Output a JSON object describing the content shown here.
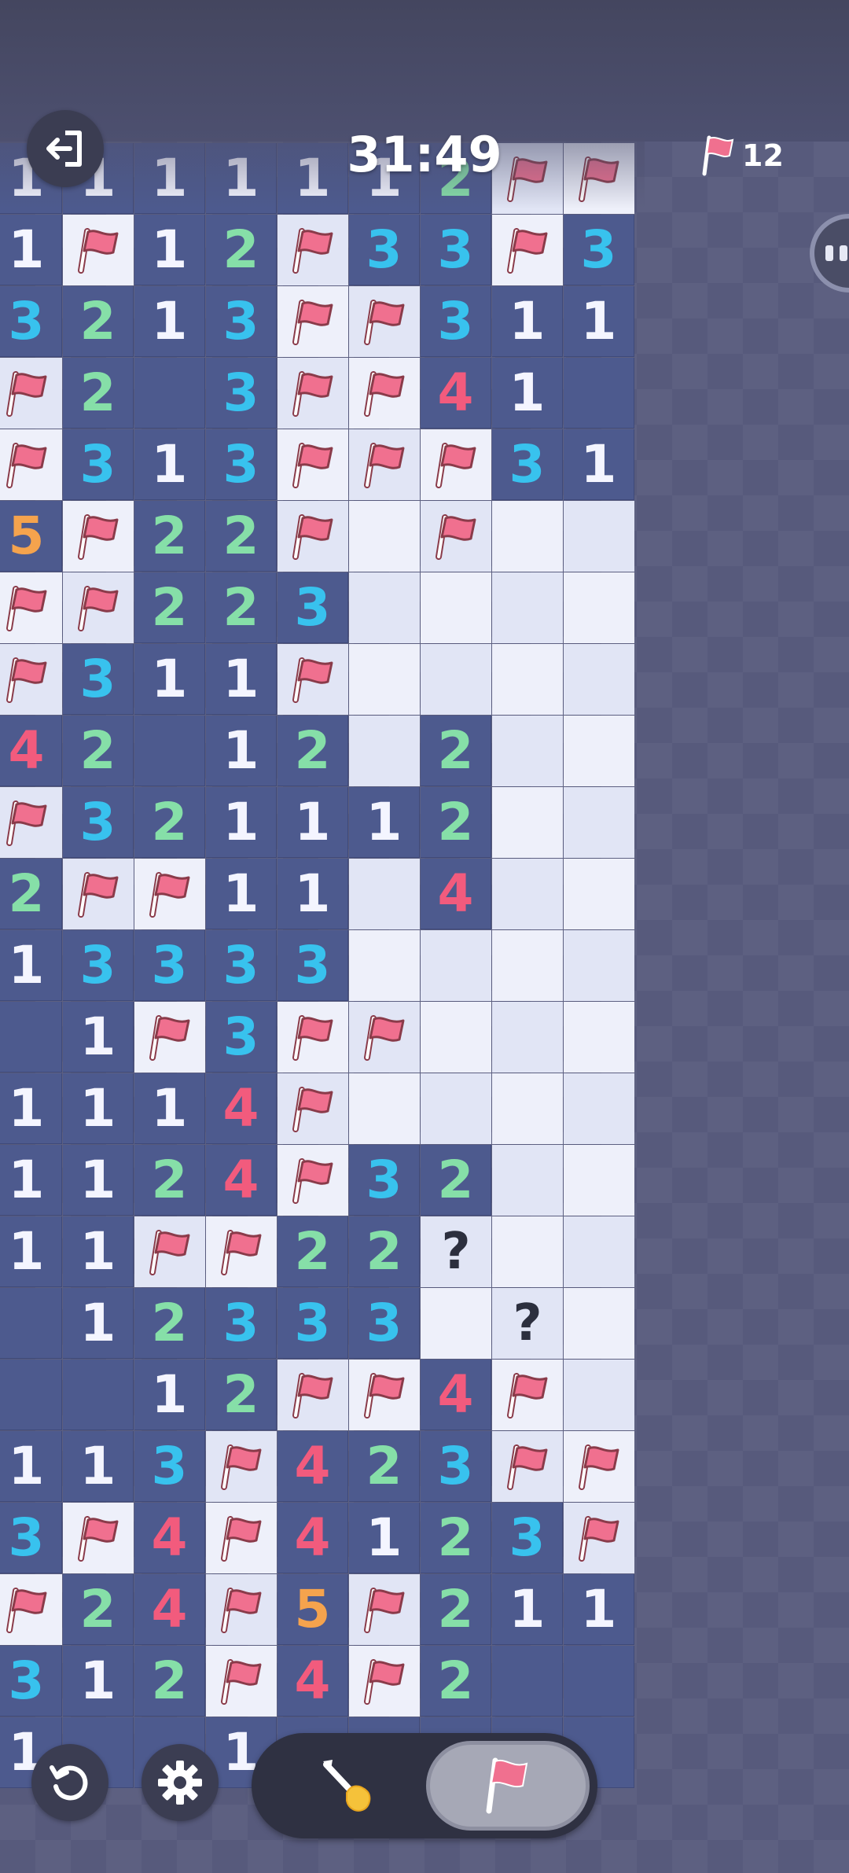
{
  "game": {
    "timer": "31:49",
    "flags_remaining": "12",
    "mode": "flag"
  },
  "icons": {
    "exit": "exit-icon",
    "flag_counter": "flag-icon",
    "side_handle": "side-panel-handle-icon",
    "undo": "undo-icon",
    "settings": "gear-icon",
    "dig": "shovel-icon",
    "flag_mode": "flag-icon"
  },
  "colors": {
    "open_cell": "#4d5a8e",
    "hidden_light": "#eef0fa",
    "hidden_dark": "#e1e5f5",
    "num1": "#f4f5ff",
    "num2": "#86dfa8",
    "num3": "#38c2ee",
    "num4": "#f25b7d",
    "num5": "#f5a34d",
    "flag": "#f0708f"
  },
  "board": {
    "legend": "digits = revealed count, F = flag, ? = question mark, . = open empty, # = unrevealed",
    "rows": [
      [
        "1",
        "1",
        "1",
        "1",
        "1",
        "1",
        "2",
        "F",
        "F"
      ],
      [
        "1",
        "F",
        "1",
        "2",
        "F",
        "3",
        "3",
        "F",
        "3"
      ],
      [
        "3",
        "2",
        "1",
        "3",
        "F",
        "F",
        "3",
        "1",
        "1"
      ],
      [
        "F",
        "2",
        ".",
        "3",
        "F",
        "F",
        "4",
        "1",
        "."
      ],
      [
        "F",
        "3",
        "1",
        "3",
        "F",
        "F",
        "F",
        "3",
        "1"
      ],
      [
        "5",
        "F",
        "2",
        "2",
        "F",
        "#",
        "F",
        "#",
        "#"
      ],
      [
        "F",
        "F",
        "2",
        "2",
        "3",
        "#",
        "#",
        "#",
        "#"
      ],
      [
        "F",
        "3",
        "1",
        "1",
        "F",
        "#",
        "#",
        "#",
        "#"
      ],
      [
        "4",
        "2",
        ".",
        "1",
        "2",
        "#",
        "2",
        "#",
        "#"
      ],
      [
        "F",
        "3",
        "2",
        "1",
        "1",
        "1",
        "2",
        "#",
        "#"
      ],
      [
        "2",
        "F",
        "F",
        "1",
        "1",
        "#",
        "4",
        "#",
        "#"
      ],
      [
        "1",
        "3",
        "3",
        "3",
        "3",
        "#",
        "#",
        "#",
        "#"
      ],
      [
        ".",
        "1",
        "F",
        "3",
        "F",
        "F",
        "#",
        "#",
        "#"
      ],
      [
        "1",
        "1",
        "1",
        "4",
        "F",
        "#",
        "#",
        "#",
        "#"
      ],
      [
        "1",
        "1",
        "2",
        "4",
        "F",
        "3",
        "2",
        "#",
        "#"
      ],
      [
        "1",
        "1",
        "F",
        "F",
        "2",
        "2",
        "?",
        "#",
        "#"
      ],
      [
        ".",
        "1",
        "2",
        "3",
        "3",
        "3",
        "#",
        "?",
        "#"
      ],
      [
        ".",
        ".",
        "1",
        "2",
        "F",
        "F",
        "4",
        "F",
        "#"
      ],
      [
        "1",
        "1",
        "3",
        "F",
        "4",
        "2",
        "3",
        "F",
        "F"
      ],
      [
        "3",
        "F",
        "4",
        "F",
        "4",
        "1",
        "2",
        "3",
        "F"
      ],
      [
        "F",
        "2",
        "4",
        "F",
        "5",
        "F",
        "2",
        "1",
        "1"
      ],
      [
        "3",
        "1",
        "2",
        "F",
        "4",
        "F",
        "2",
        ".",
        "."
      ],
      [
        "1",
        ".",
        ".",
        "1",
        ".",
        ".",
        ".",
        ".",
        "."
      ]
    ]
  }
}
